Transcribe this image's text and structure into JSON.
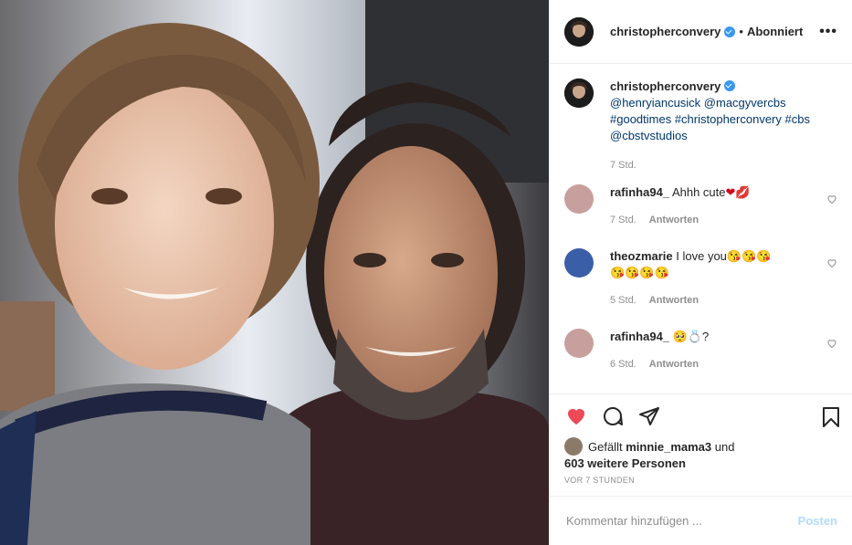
{
  "header": {
    "username": "christopherconvery",
    "separator": "•",
    "follow_state": "Abonniert",
    "more": "•••"
  },
  "caption": {
    "username": "christopherconvery",
    "line1": "@henryiancusick @macgyvercbs",
    "line2": "#goodtimes #christopherconvery #cbs",
    "line3": "@cbstvstudios",
    "time": "7 Std."
  },
  "comments": [
    {
      "username": "rafinha94_",
      "text": "Ahhh cute",
      "emoji": "❤💋",
      "time": "7 Std.",
      "reply": "Antworten"
    },
    {
      "username": "theozmarie",
      "text": "I love you",
      "emoji": "😘😘😘",
      "emoji2": "😘😘😘😘",
      "time": "5 Std.",
      "reply": "Antworten"
    },
    {
      "username": "rafinha94_",
      "text": "",
      "emoji": "🥺💍?",
      "time": "6 Std.",
      "reply": "Antworten"
    }
  ],
  "likes": {
    "prefix": "Gefällt",
    "user": "minnie_mama3",
    "conj": "und",
    "others": "603 weitere Personen"
  },
  "posted_ago": "VOR 7 STUNDEN",
  "add_comment": {
    "placeholder": "Kommentar hinzufügen ...",
    "post_label": "Posten"
  },
  "colors": {
    "like_red": "#ed4956",
    "link": "#00376b",
    "verified": "#3897f0",
    "post_disabled": "#b3dbff"
  },
  "icons": [
    "heart-filled-icon",
    "comment-icon",
    "share-icon",
    "bookmark-icon",
    "verified-icon",
    "heart-outline-icon"
  ]
}
